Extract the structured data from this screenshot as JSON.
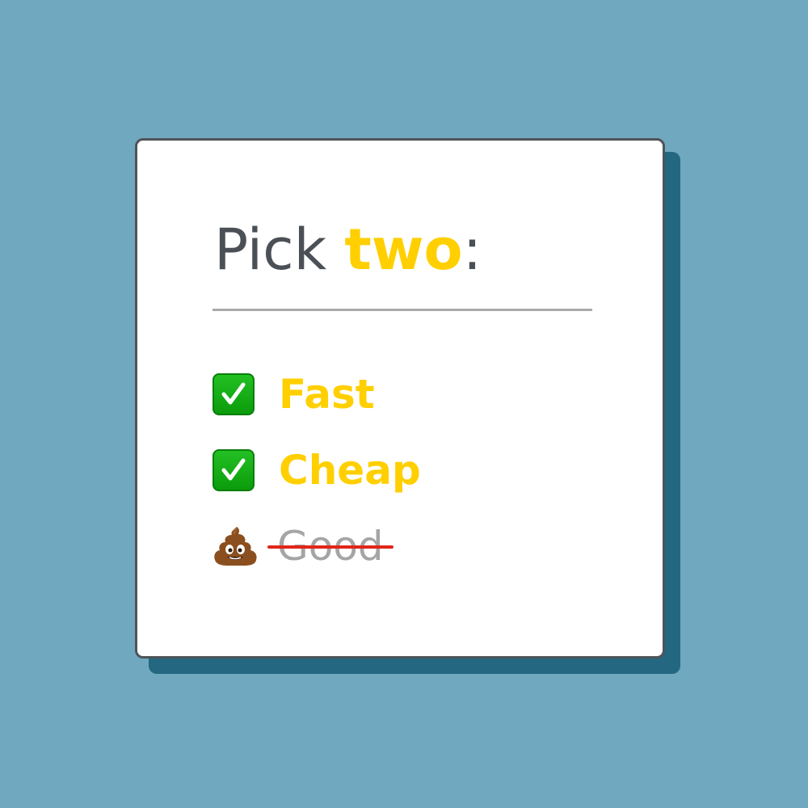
{
  "card": {
    "title_prefix": "Pick ",
    "title_accent": "two",
    "title_suffix": ":"
  },
  "items": [
    {
      "icon": "check-mark-button-icon",
      "label": "Fast",
      "state": "checked"
    },
    {
      "icon": "check-mark-button-icon",
      "label": "Cheap",
      "state": "checked"
    },
    {
      "icon": "pile-of-poo-icon",
      "label": "Good",
      "state": "struck-through"
    }
  ],
  "colors": {
    "background": "#6fa8bf",
    "card_shadow": "#246781",
    "accent": "#ffcf00",
    "heading_text": "#4b5056",
    "struck_text": "#a5a5a5",
    "strike_line": "#e1251b",
    "check_green": "#16b016"
  }
}
